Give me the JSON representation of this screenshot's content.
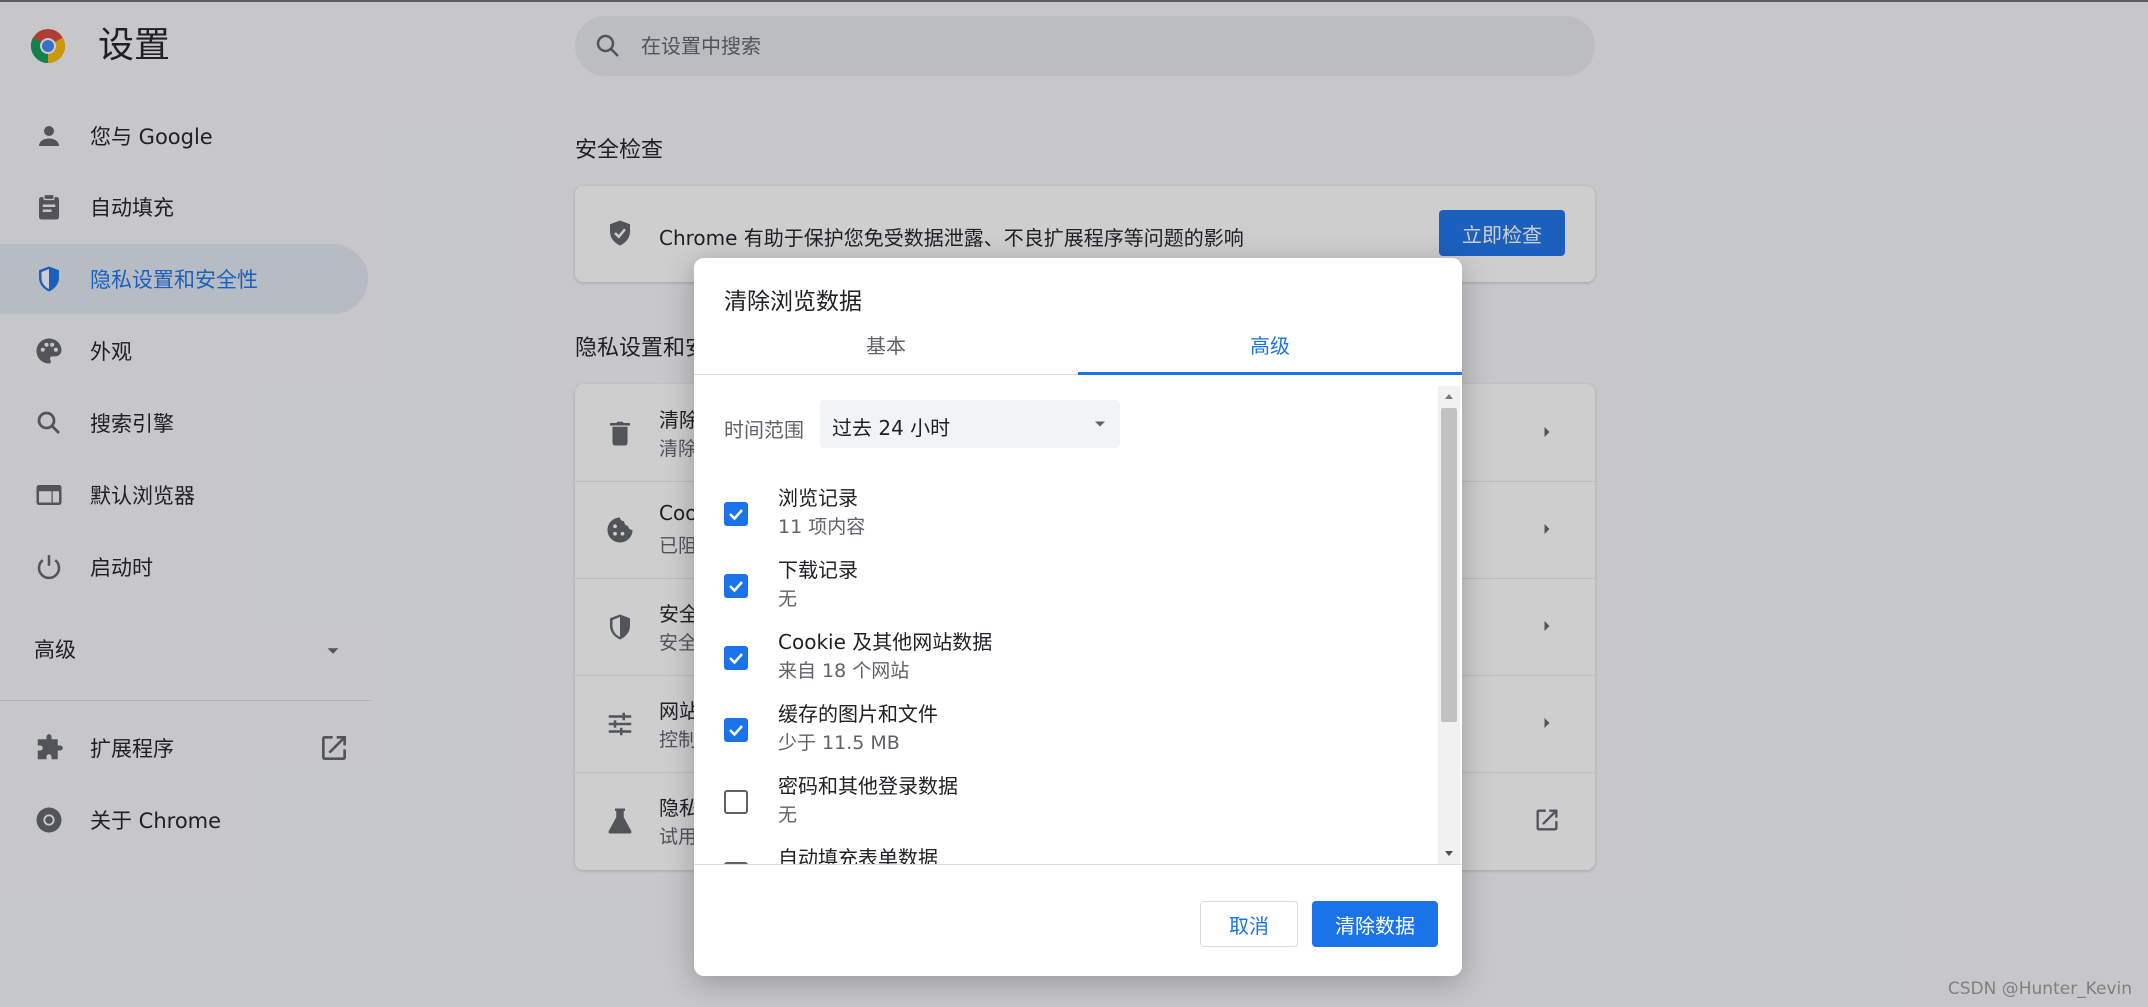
{
  "app": {
    "title": "设置"
  },
  "search": {
    "placeholder": "在设置中搜索"
  },
  "sidebar": {
    "items": [
      {
        "label": "您与 Google",
        "icon": "person-icon"
      },
      {
        "label": "自动填充",
        "icon": "clipboard-icon"
      },
      {
        "label": "隐私设置和安全性",
        "icon": "shield-icon",
        "active": true
      },
      {
        "label": "外观",
        "icon": "palette-icon"
      },
      {
        "label": "搜索引擎",
        "icon": "search-icon"
      },
      {
        "label": "默认浏览器",
        "icon": "browser-window-icon"
      },
      {
        "label": "启动时",
        "icon": "power-icon"
      }
    ],
    "advanced_label": "高级",
    "extensions_label": "扩展程序",
    "about_label": "关于 Chrome"
  },
  "safety_check": {
    "section_title": "安全检查",
    "text": "Chrome 有助于保护您免受数据泄露、不良扩展程序等问题的影响",
    "button_label": "立即检查"
  },
  "privacy": {
    "section_title": "隐私设置和安",
    "rows": [
      {
        "title": "清除",
        "subtitle": "清除",
        "icon": "trash-icon"
      },
      {
        "title": "Coo",
        "subtitle": "已阻",
        "icon": "cookie-icon"
      },
      {
        "title": "安全",
        "subtitle": "安全",
        "icon": "shield-icon"
      },
      {
        "title": "网站",
        "subtitle": "控制",
        "icon": "sliders-icon"
      },
      {
        "title": "隐私",
        "subtitle": "试用",
        "icon": "flask-icon"
      }
    ]
  },
  "dialog": {
    "title": "清除浏览数据",
    "tabs": [
      {
        "label": "基本",
        "selected": false
      },
      {
        "label": "高级",
        "selected": true
      }
    ],
    "time_range_label": "时间范围",
    "time_range_value": "过去 24 小时",
    "options": [
      {
        "title": "浏览记录",
        "subtitle": "11 项内容",
        "checked": true
      },
      {
        "title": "下载记录",
        "subtitle": "无",
        "checked": true
      },
      {
        "title": "Cookie 及其他网站数据",
        "subtitle": "来自 18 个网站",
        "checked": true
      },
      {
        "title": "缓存的图片和文件",
        "subtitle": "少于 11.5 MB",
        "checked": true
      },
      {
        "title": "密码和其他登录数据",
        "subtitle": "无",
        "checked": false
      },
      {
        "title": "自动填充表单数据",
        "subtitle": "",
        "checked": false
      }
    ],
    "cancel_label": "取消",
    "confirm_label": "清除数据"
  },
  "colors": {
    "accent": "#1a73e8",
    "active_nav_bg": "#e1e7f1"
  },
  "watermark": "CSDN @Hunter_Kevin"
}
